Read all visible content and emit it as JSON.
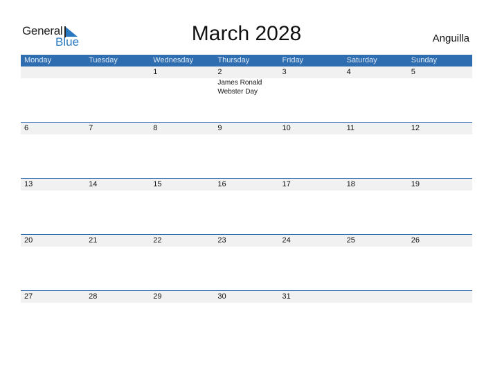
{
  "logo": {
    "text_general": "General",
    "text_blue": "Blue"
  },
  "title": "March 2028",
  "country": "Anguilla",
  "colors": {
    "header_bg": "#2e6db0",
    "accent": "#2a79c0",
    "date_strip": "#f1f1f1"
  },
  "weekdays": [
    "Monday",
    "Tuesday",
    "Wednesday",
    "Thursday",
    "Friday",
    "Saturday",
    "Sunday"
  ],
  "weeks": [
    {
      "days": [
        "",
        "",
        "1",
        "2",
        "3",
        "4",
        "5"
      ],
      "events": [
        "",
        "",
        "",
        "James Ronald Webster Day",
        "",
        "",
        ""
      ]
    },
    {
      "days": [
        "6",
        "7",
        "8",
        "9",
        "10",
        "11",
        "12"
      ],
      "events": [
        "",
        "",
        "",
        "",
        "",
        "",
        ""
      ]
    },
    {
      "days": [
        "13",
        "14",
        "15",
        "16",
        "17",
        "18",
        "19"
      ],
      "events": [
        "",
        "",
        "",
        "",
        "",
        "",
        ""
      ]
    },
    {
      "days": [
        "20",
        "21",
        "22",
        "23",
        "24",
        "25",
        "26"
      ],
      "events": [
        "",
        "",
        "",
        "",
        "",
        "",
        ""
      ]
    },
    {
      "days": [
        "27",
        "28",
        "29",
        "30",
        "31",
        "",
        ""
      ],
      "events": [
        "",
        "",
        "",
        "",
        "",
        "",
        ""
      ]
    }
  ]
}
